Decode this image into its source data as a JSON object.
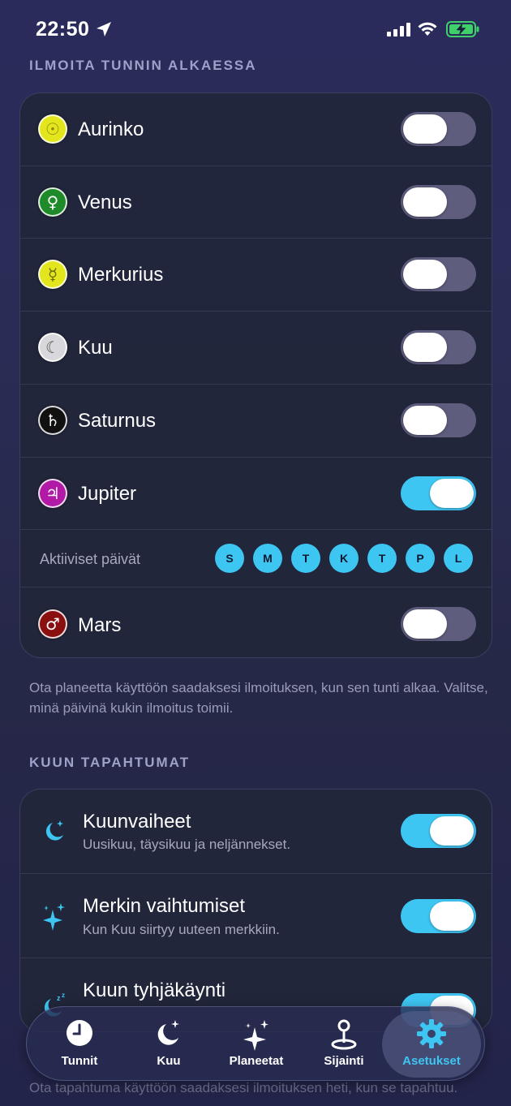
{
  "status_bar": {
    "time": "22:50"
  },
  "sections": {
    "hour_start_title": "ILMOITA TUNNIN ALKAESSA",
    "moon_events_title": "KUUN TAPAHTUMAT"
  },
  "planets": [
    {
      "name": "Aurinko",
      "symbol": "☉",
      "color": "#e3e61c",
      "on": false
    },
    {
      "name": "Venus",
      "symbol": "♀",
      "color": "#1f8a2a",
      "on": false
    },
    {
      "name": "Merkurius",
      "symbol": "☿",
      "color": "#e3e61c",
      "on": false
    },
    {
      "name": "Kuu",
      "symbol": "☾",
      "color": "#d8d8dc",
      "on": false
    },
    {
      "name": "Saturnus",
      "symbol": "♄",
      "color": "#111111",
      "on": false
    },
    {
      "name": "Jupiter",
      "symbol": "♃",
      "color": "#b01aa6",
      "on": true
    },
    {
      "name": "Mars",
      "symbol": "♂",
      "color": "#8a1010",
      "on": false
    }
  ],
  "active_days": {
    "label": "Aktiiviset päivät",
    "days": [
      "S",
      "M",
      "T",
      "K",
      "T",
      "P",
      "L"
    ]
  },
  "helper_text_1": "Ota planeetta käyttöön saadaksesi ilmoituksen, kun sen tunti alkaa. Valitse, minä päivinä kukin ilmoitus toimii.",
  "moon_events": [
    {
      "title": "Kuunvaiheet",
      "subtitle": "Uusikuu, täysikuu ja neljännekset.",
      "icon": "moon-stars-icon",
      "on": true
    },
    {
      "title": "Merkin vaihtumiset",
      "subtitle": "Kun Kuu siirtyy uuteen merkkiin.",
      "icon": "sparkles-icon",
      "on": true
    },
    {
      "title": "Kuun tyhjäkäynti",
      "subtitle": "",
      "icon": "moon-zzz-icon",
      "on": true
    }
  ],
  "helper_text_2": "Ota tapahtuma käyttöön saadaksesi ilmoituksen heti, kun se tapahtuu.",
  "tabs": [
    {
      "label": "Tunnit",
      "icon": "clock-icon",
      "active": false
    },
    {
      "label": "Kuu",
      "icon": "moon-stars-icon",
      "active": false
    },
    {
      "label": "Planeetat",
      "icon": "sparkles-icon",
      "active": false
    },
    {
      "label": "Sijainti",
      "icon": "location-pin-icon",
      "active": false
    },
    {
      "label": "Asetukset",
      "icon": "gear-icon",
      "active": true
    }
  ],
  "colors": {
    "accent": "#3ec6f3",
    "toggle_off": "#5f5d7e"
  }
}
